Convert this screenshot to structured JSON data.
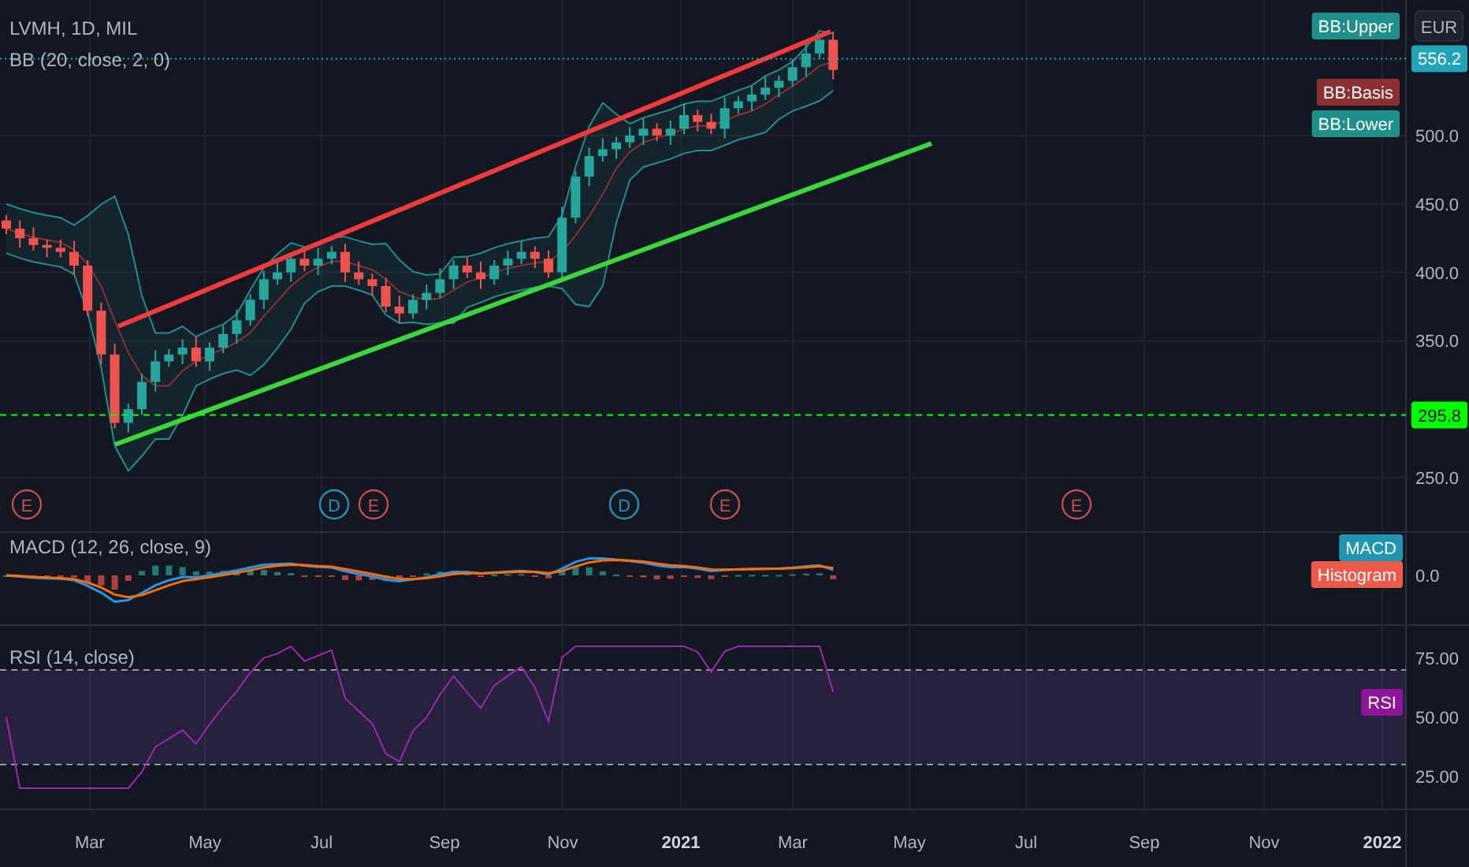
{
  "main_pane": {
    "symbol_title": "LVMH, 1D, MIL",
    "indicator_legend": "BB (20, close, 2, 0)",
    "currency": "EUR",
    "badges": [
      {
        "text": "BB:Upper",
        "color": "#1f8f8c"
      },
      {
        "text": "BB:Basis",
        "color": "#8c2f33"
      },
      {
        "text": "BB:Lower",
        "color": "#1f8f8c"
      }
    ],
    "price_axis_labels": [
      "500.0",
      "450.0",
      "400.0",
      "350.0",
      "250.0"
    ],
    "price_labels": [
      {
        "text": "556.2",
        "kind": "last",
        "color": "#22a4b8"
      },
      {
        "text": "295.8",
        "kind": "support",
        "color": "#00ff00"
      }
    ],
    "events": [
      {
        "label": "E",
        "kind": "earnings"
      },
      {
        "label": "D",
        "kind": "dividend"
      },
      {
        "label": "E",
        "kind": "earnings"
      },
      {
        "label": "D",
        "kind": "dividend"
      },
      {
        "label": "E",
        "kind": "earnings"
      },
      {
        "label": "E",
        "kind": "earnings"
      }
    ]
  },
  "macd_pane": {
    "legend": "MACD (12, 26, close, 9)",
    "axis_label": "0.0",
    "badges": [
      {
        "text": "MACD",
        "color": "#2196b3"
      },
      {
        "text": "Histogram",
        "color": "#ee5a4a"
      }
    ]
  },
  "rsi_pane": {
    "legend": "RSI (14, close)",
    "axis_labels": [
      "75.00",
      "50.00",
      "25.00"
    ],
    "badges": [
      {
        "text": "RSI",
        "color": "#8e1599"
      }
    ]
  },
  "time_axis": {
    "labels": [
      {
        "text": "Mar",
        "kind": "month"
      },
      {
        "text": "May",
        "kind": "month"
      },
      {
        "text": "Jul",
        "kind": "month"
      },
      {
        "text": "Sep",
        "kind": "month"
      },
      {
        "text": "Nov",
        "kind": "month"
      },
      {
        "text": "2021",
        "kind": "year"
      },
      {
        "text": "Mar",
        "kind": "month"
      },
      {
        "text": "May",
        "kind": "month"
      },
      {
        "text": "Jul",
        "kind": "month"
      },
      {
        "text": "Sep",
        "kind": "month"
      },
      {
        "text": "Nov",
        "kind": "month"
      },
      {
        "text": "2022",
        "kind": "year"
      }
    ]
  }
}
